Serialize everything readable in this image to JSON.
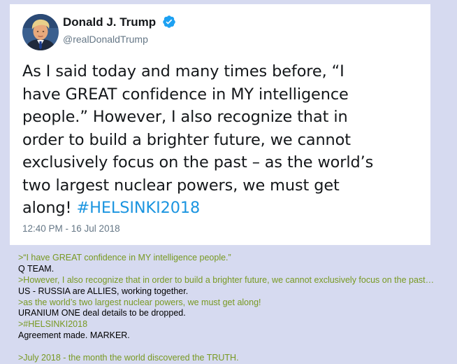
{
  "tweet": {
    "display_name": "Donald J. Trump",
    "handle": "@realDonaldTrump",
    "verified_icon": "verified-badge-icon",
    "verified_color": "#1da1f2",
    "body_lines": [
      "As I said today and many times before, “I",
      "have GREAT confidence in MY intelligence",
      "people.” However, I also recognize that in",
      "order to build a brighter future, we cannot",
      "exclusively focus on the past – as the world’s",
      "two largest nuclear powers, we must get"
    ],
    "body_last_line_prefix": "along!",
    "hashtag": "#HELSINKI2018",
    "hashtag_color": "#1b95e0",
    "timestamp": "12:40 PM - 16 Jul 2018"
  },
  "post": {
    "quote_color": "#789922",
    "lines": [
      {
        "type": "quote",
        "text": ">“I have GREAT confidence in MY intelligence people.”"
      },
      {
        "type": "plain",
        "text": "Q TEAM."
      },
      {
        "type": "quote",
        "text": ">However, I also recognize that in order to build a brighter future, we cannot exclusively focus on the past…"
      },
      {
        "type": "plain",
        "text": "US - RUSSIA are ALLIES, working together."
      },
      {
        "type": "quote",
        "text": ">as the world’s two largest nuclear powers, we must get along!"
      },
      {
        "type": "plain",
        "text": "URANIUM ONE deal details to be dropped."
      },
      {
        "type": "quote",
        "text": ">#HELSINKI2018"
      },
      {
        "type": "plain",
        "text": "Agreement made. MARKER."
      },
      {
        "type": "blank",
        "text": ""
      },
      {
        "type": "quote",
        "text": ">July 2018 - the month the world discovered the TRUTH."
      }
    ]
  }
}
